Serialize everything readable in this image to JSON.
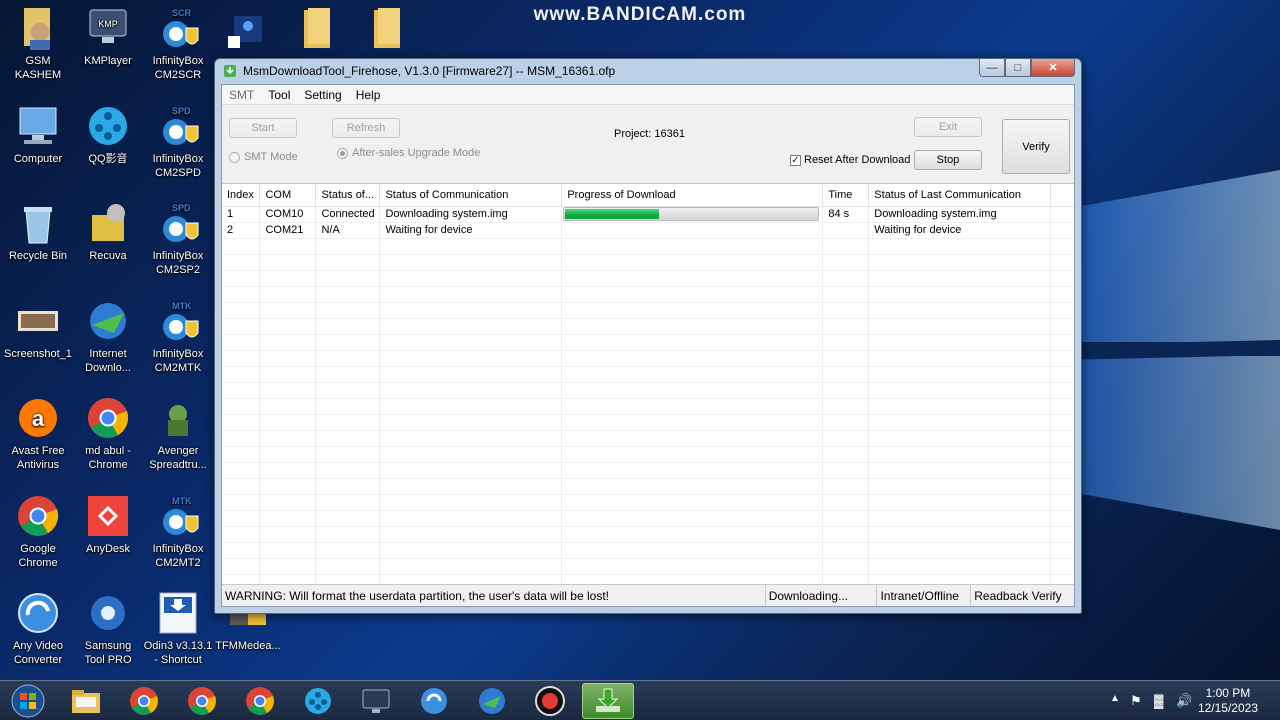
{
  "watermark": "www.BANDICAM.com",
  "desktop": {
    "icons": [
      {
        "label": "GSM\nKASHEM"
      },
      {
        "label": "KMPlayer"
      },
      {
        "label": "InfinityBox\nCM2SCR"
      },
      {
        "label": ""
      },
      {
        "label": ""
      },
      {
        "label": ""
      },
      {
        "label": "Computer"
      },
      {
        "label": "QQ影音"
      },
      {
        "label": "InfinityBox\nCM2SPD"
      },
      {
        "label": "Recycle Bin"
      },
      {
        "label": "Recuva"
      },
      {
        "label": "InfinityBox\nCM2SP2"
      },
      {
        "label": "Screenshot_1"
      },
      {
        "label": "Internet\nDownlo..."
      },
      {
        "label": "InfinityBox\nCM2MTK"
      },
      {
        "label": "Avast Free\nAntivirus"
      },
      {
        "label": "md abul -\nChrome"
      },
      {
        "label": "Avenger\nSpreadtru..."
      },
      {
        "label": "Google\nChrome"
      },
      {
        "label": "AnyDesk"
      },
      {
        "label": "InfinityBox\nCM2MT2"
      },
      {
        "label": "Any Video\nConverter"
      },
      {
        "label": "Samsung\nTool PRO"
      },
      {
        "label": "Odin3 v3.13.1\n- Shortcut"
      },
      {
        "label": "TFMMedea..."
      }
    ],
    "icon_tags": {
      "kmp": "KMP",
      "scr": "SCR",
      "spd": "SPD",
      "mtk": "MTK"
    }
  },
  "window": {
    "title": "MsmDownloadTool_Firehose, V1.3.0 [Firmware27] -- MSM_16361.ofp",
    "menu": [
      "SMT",
      "Tool",
      "Setting",
      "Help"
    ],
    "buttons": {
      "start": "Start",
      "refresh": "Refresh",
      "exit": "Exit",
      "stop": "Stop",
      "verify": "Verify"
    },
    "project_label": "Project:",
    "project_value": "16361",
    "smt_mode": "SMT Mode",
    "after_sales_mode": "After-sales Upgrade Mode",
    "reset_after_download": "Reset After Download",
    "table": {
      "headers": [
        "Index",
        "COM",
        "Status of...",
        "Status of Communication",
        "Progress of Download",
        "Time",
        "Status of Last Communication"
      ],
      "rows": [
        {
          "index": "1",
          "com": "COM10",
          "status": "Connected",
          "comm": "Downloading system.img",
          "progress": 0.37,
          "time": "84 s",
          "last": "Downloading system.img"
        },
        {
          "index": "2",
          "com": "COM21",
          "status": "N/A",
          "comm": "Waiting for device",
          "progress": null,
          "time": "",
          "last": "Waiting for device"
        }
      ]
    },
    "statusbar": {
      "warning": "WARNING: Will format the userdata partition, the user's data will be lost!",
      "state": "Downloading...",
      "network": "Intranet/Offline",
      "readback": "Readback Verify"
    }
  },
  "taskbar": {
    "clock_time": "1:00 PM",
    "clock_date": "12/15/2023"
  },
  "colors": {
    "progress": "#11a945",
    "desktop": "#0b3a8c",
    "close": "#c7452f"
  }
}
